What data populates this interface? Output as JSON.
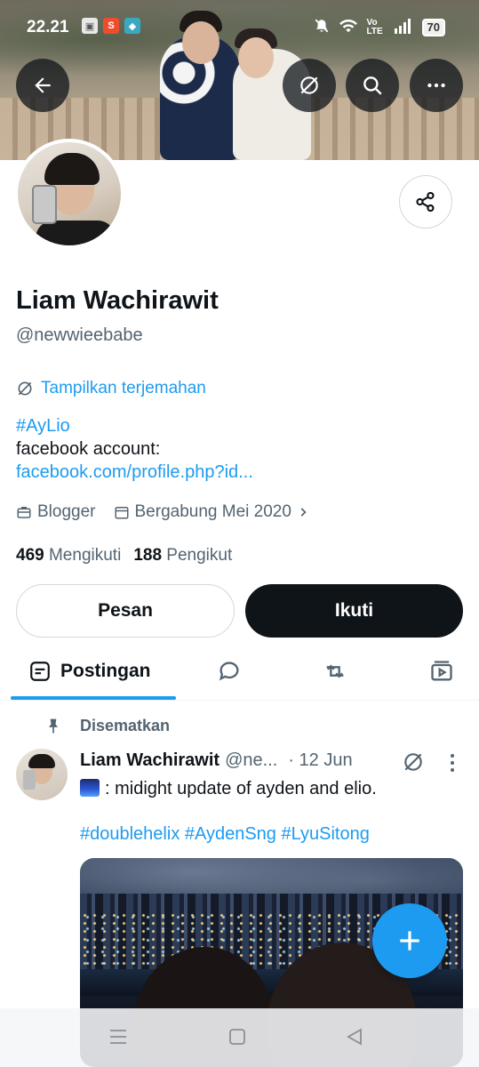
{
  "status_bar": {
    "time": "22.21",
    "notif_icons": [
      "photo-icon",
      "shop-icon",
      "app-icon"
    ],
    "network": "Vo LTE",
    "battery": "70"
  },
  "header": {
    "back_icon": "arrow-left-icon",
    "translate_icon": "translate-icon",
    "search_icon": "search-icon",
    "more_icon": "more-horizontal-icon"
  },
  "profile": {
    "display_name": "Liam Wachirawit",
    "handle": "@newwieebabe",
    "translate_label": "Tampilkan terjemahan",
    "bio_tag": "#AyLio",
    "bio_line": "facebook account:",
    "bio_link": "facebook.com/profile.php?id...",
    "category": "Blogger",
    "joined": "Bergabung Mei 2020",
    "following_count": "469",
    "following_label": "Mengikuti",
    "followers_count": "188",
    "followers_label": "Pengikut"
  },
  "actions": {
    "message": "Pesan",
    "follow": "Ikuti"
  },
  "tabs": {
    "posts": "Postingan",
    "replies_icon": "reply-icon",
    "reposts_icon": "repost-icon",
    "media_icon": "media-icon"
  },
  "post": {
    "pinned_label": "Disematkan",
    "author": "Liam Wachirawit",
    "handle": "@ne...",
    "date": "· 12 Jun",
    "text": ": midight update of ayden and elio.",
    "hashtags": "#doublehelix #AydenSng #LyuSitong"
  },
  "colors": {
    "accent": "#1d9bf0",
    "text": "#0f1419",
    "muted": "#536471",
    "follow_bg": "#0f1419"
  }
}
